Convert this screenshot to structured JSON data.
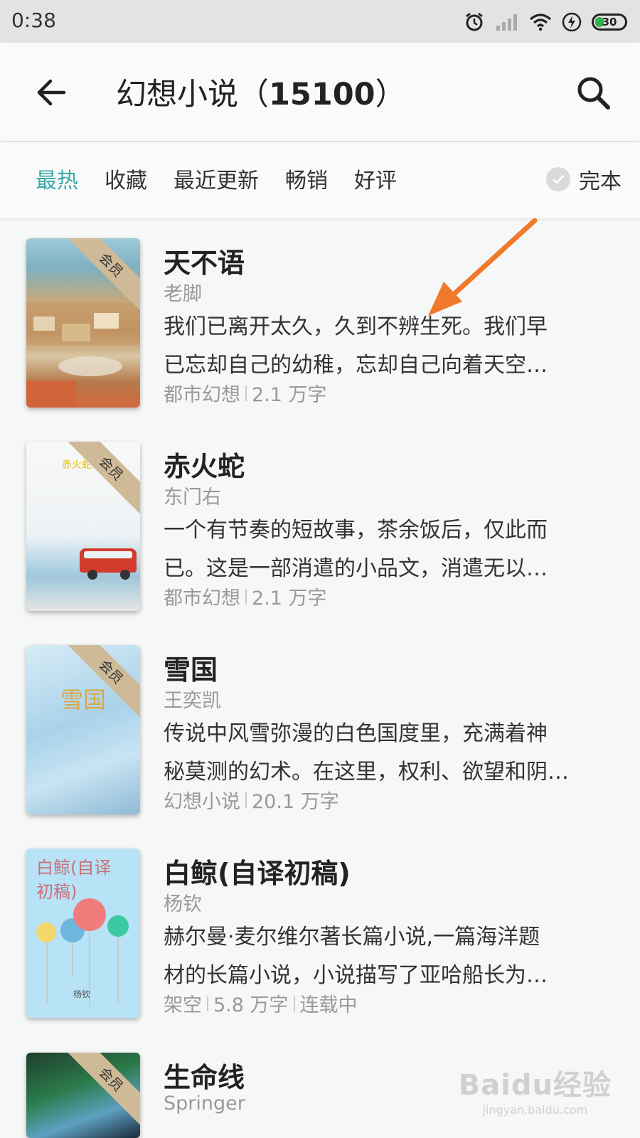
{
  "status_bar": {
    "time": "0:38",
    "battery": "30"
  },
  "header": {
    "title_name": "幻想小说",
    "title_paren_open": "（",
    "title_count": "15100",
    "title_paren_close": "）"
  },
  "filters": {
    "tabs": [
      "最热",
      "收藏",
      "最近更新",
      "畅销",
      "好评"
    ],
    "active_tab": "最热",
    "complete_label": "完本"
  },
  "badge_label": "会员",
  "books": [
    {
      "title": "天不语",
      "author": "老脚",
      "desc_line1": "我们已离开太久，久到不辨生死。我们早",
      "desc_line2": "已忘却自己的幼稚，忘却自己向着天空…",
      "category": "都市幻想",
      "words": "2.1 万字",
      "status": ""
    },
    {
      "title": "赤火蛇",
      "author": "东门右",
      "desc_line1": "一个有节奏的短故事，茶余饭后，仅此而",
      "desc_line2": "已。这是一部消遣的小品文，消遣无以…",
      "category": "都市幻想",
      "words": "2.1 万字",
      "status": ""
    },
    {
      "title": "雪国",
      "author": "王奕凯",
      "desc_line1": "传说中风雪弥漫的白色国度里，充满着神",
      "desc_line2": "秘莫测的幻术。在这里，权利、欲望和阴…",
      "category": "幻想小说",
      "words": "20.1 万字",
      "status": ""
    },
    {
      "title": "白鲸(自译初稿)",
      "author": "杨钦",
      "desc_line1": "赫尔曼·麦尔维尔著长篇小说,一篇海洋题",
      "desc_line2": "材的长篇小说，小说描写了亚哈船长为…",
      "category": "架空",
      "words": "5.8 万字",
      "status": "连载中"
    },
    {
      "title": "生命线",
      "author": "Springer"
    }
  ],
  "covers": {
    "cover2_title": "赤火蛇",
    "cover3_title": "雪国",
    "cover4_title_line1": "白鲸(自译",
    "cover4_title_line2": "初稿)",
    "cover4_author": "杨钦"
  },
  "watermark": {
    "main": "Baidu经验",
    "sub": "jingyan.baidu.com"
  },
  "colors": {
    "accent": "#3aa8a8",
    "arrow": "#f07a2a",
    "badge": "#cfba98"
  },
  "icons": [
    "back-arrow-icon",
    "search-icon",
    "check-icon",
    "alarm-icon",
    "signal-icon",
    "wifi-icon",
    "charging-icon"
  ]
}
